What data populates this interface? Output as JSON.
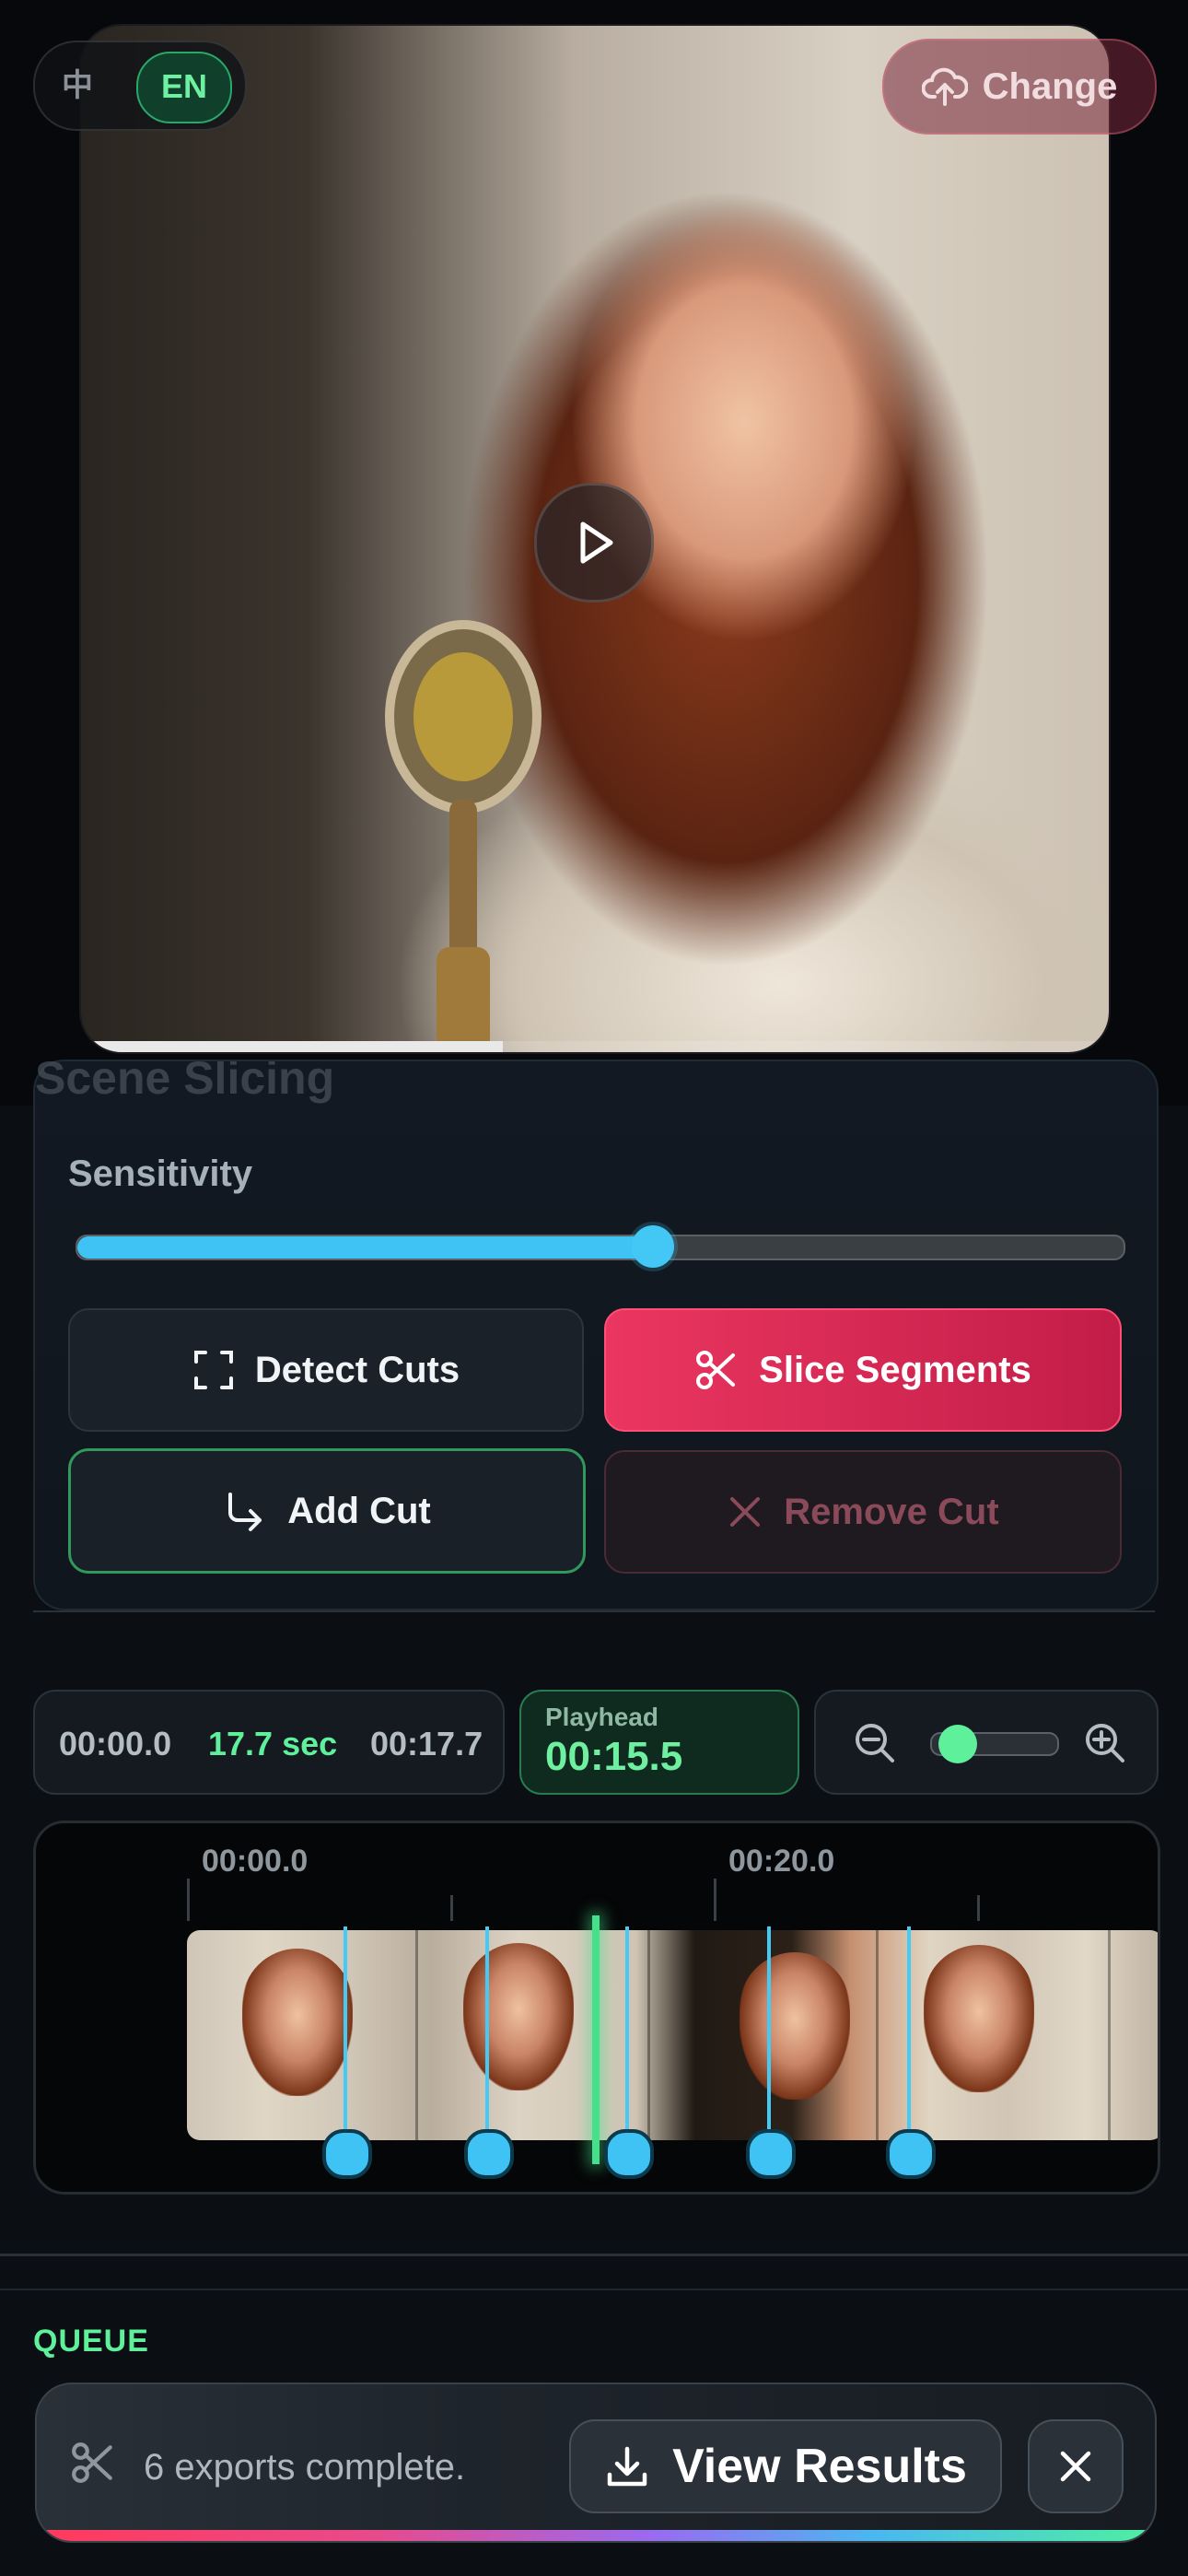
{
  "lang": {
    "zh": "中",
    "en": "EN"
  },
  "header": {
    "change_label": "Change"
  },
  "video": {
    "progress": 0.41
  },
  "slicing": {
    "title": "Scene Slicing",
    "sensitivity_label": "Sensitivity",
    "sensitivity_value": 0.55,
    "detect_label": "Detect Cuts",
    "slice_label": "Slice Segments",
    "add_cut_label": "Add Cut",
    "remove_cut_label": "Remove Cut"
  },
  "timing": {
    "start": "00:00.0",
    "duration": "17.7 sec",
    "end": "00:17.7",
    "playhead_label": "Playhead",
    "playhead_value": "00:15.5"
  },
  "zoom": {
    "level": 0.05
  },
  "timeline": {
    "tick_labels": [
      "00:00.0",
      "00:20.0"
    ],
    "cut_count": 5,
    "playhead_time": "00:15.5"
  },
  "queue": {
    "label": "QUEUE"
  },
  "toast": {
    "message": "6 exports complete.",
    "view_label": "View Results"
  },
  "colors": {
    "accent_green": "#5ef09a",
    "accent_blue": "#3ec3f4",
    "accent_red": "#ea3660"
  }
}
